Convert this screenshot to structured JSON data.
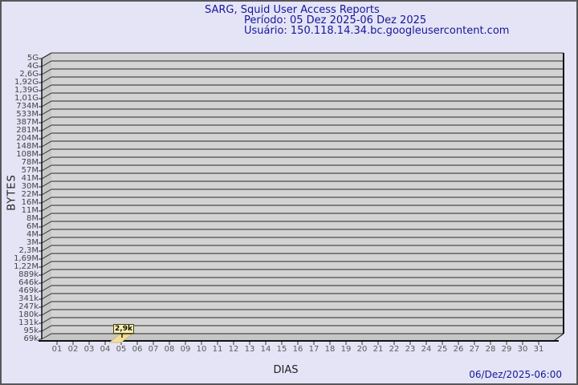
{
  "title": {
    "line1": "SARG, Squid User Access Reports",
    "line2": "Período: 05 Dez 2025-06 Dez 2025",
    "line3": "Usuário: 150.118.14.34.bc.googleusercontent.com"
  },
  "footer": {
    "timestamp": "06/Dez/2025-06:00"
  },
  "chart_data": {
    "type": "bar",
    "title": "SARG, Squid User Access Reports",
    "subtitle": "Período: 05 Dez 2025-06 Dez 2025",
    "user": "150.118.14.34.bc.googleusercontent.com",
    "xlabel": "DIAS",
    "ylabel": "BYTES",
    "scale": "log",
    "grid": true,
    "legend": "none",
    "categories": [
      "01",
      "02",
      "03",
      "04",
      "05",
      "06",
      "07",
      "08",
      "09",
      "10",
      "11",
      "12",
      "13",
      "14",
      "15",
      "16",
      "17",
      "18",
      "19",
      "20",
      "21",
      "22",
      "23",
      "24",
      "25",
      "26",
      "27",
      "28",
      "29",
      "30",
      "31"
    ],
    "values": [
      0,
      0,
      0,
      0,
      2900,
      0,
      0,
      0,
      0,
      0,
      0,
      0,
      0,
      0,
      0,
      0,
      0,
      0,
      0,
      0,
      0,
      0,
      0,
      0,
      0,
      0,
      0,
      0,
      0,
      0,
      0
    ],
    "bar_label": "2,9k",
    "bar_day": "05",
    "ytick_labels": [
      "5G",
      "4G",
      "2,6G",
      "1,92G",
      "1,39G",
      "1,01G",
      "734M",
      "533M",
      "387M",
      "281M",
      "204M",
      "148M",
      "108M",
      "78M",
      "57M",
      "41M",
      "30M",
      "22M",
      "16M",
      "11M",
      "8M",
      "6M",
      "4M",
      "3M",
      "2,3M",
      "1,69M",
      "1,22M",
      "889k",
      "646k",
      "469k",
      "341k",
      "247k",
      "180k",
      "131k",
      "95k",
      "69k"
    ],
    "ylim_labels": [
      "69k",
      "5G"
    ],
    "colors": {
      "background": "#e4e4f6",
      "plot_bg": "#d3d3d3",
      "wall": "#c6c6c6",
      "gridline": "#2a2a2a",
      "axis_edge": "#111111",
      "bar_fill": "#f2de9c",
      "tooltip_bg": "#faf0ae",
      "title_text": "#16169a"
    }
  }
}
